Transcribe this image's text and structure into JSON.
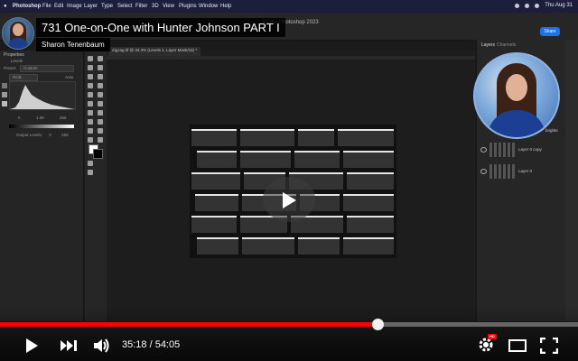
{
  "menubar": {
    "app": "Photoshop",
    "items": [
      "File",
      "Edit",
      "Image",
      "Layer",
      "Type",
      "Select",
      "Filter",
      "3D",
      "View",
      "Plugins",
      "Window",
      "Help"
    ],
    "clock": "Thu Aug 31"
  },
  "photoshop": {
    "window_title": "Adobe Photoshop 2023",
    "share_label": "Share",
    "document_tab": "Zigzag.tif @ 33.3% (Levels 1, Layer Mask/16) *",
    "properties": {
      "tab": "Properties",
      "sub_label": "Levels",
      "preset_label": "Preset:",
      "preset_value": "Custom",
      "channel_value": "RGB",
      "auto_label": "Auto",
      "input_values": [
        "0",
        "1.00",
        "255"
      ],
      "output_label": "Output Levels:",
      "output_values": [
        "0",
        "255"
      ]
    },
    "layers": {
      "tab_layers": "Layers",
      "tab_channels": "Channels",
      "rows": [
        {
          "name": "brighte"
        },
        {
          "name": "Layer 0 copy"
        },
        {
          "name": "Layer 0"
        }
      ]
    }
  },
  "video": {
    "title": "731 One-on-One with Hunter Johnson PART I",
    "channel": "Sharon Tenenbaum",
    "current_time": "35:18",
    "duration": "54:05",
    "time_text": "35:18 / 54:05",
    "progress": 0.653,
    "hd_badge": "HD",
    "accent_color": "#ff0000"
  }
}
